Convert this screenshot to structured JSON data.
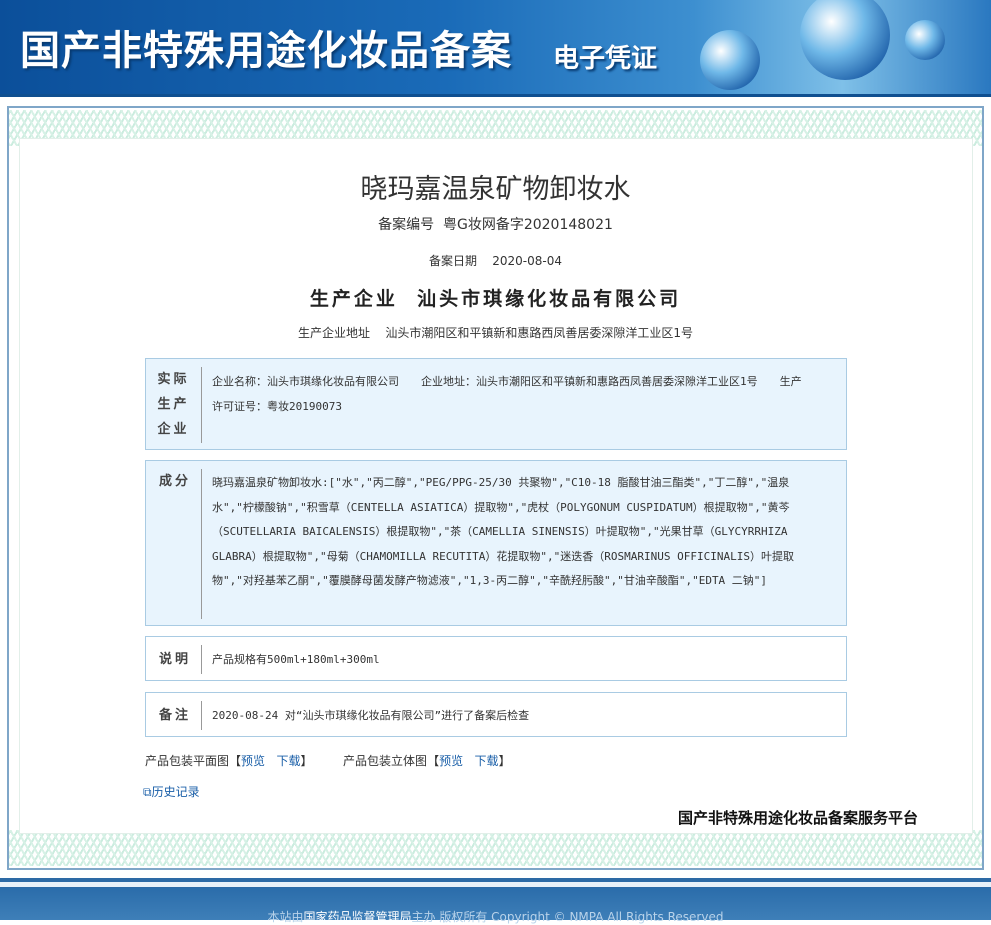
{
  "banner": {
    "title": "国产非特殊用途化妆品备案",
    "subtitle": "电子凭证"
  },
  "product": {
    "name": "晓玛嘉温泉矿物卸妆水",
    "reg_label": "备案编号",
    "reg_no": "粤G妆网备字2020148021",
    "date_label": "备案日期",
    "date": "2020-08-04",
    "maker_label": "生产企业",
    "maker": "汕头市琪缘化妆品有限公司",
    "addr_label": "生产企业地址",
    "addr": "汕头市潮阳区和平镇新和惠路西凤善居委深隙洋工业区1号"
  },
  "sections": {
    "actual": {
      "label": "实际生产企业",
      "name": "企业名称：汕头市琪缘化妆品有限公司",
      "address": "企业地址：汕头市潮阳区和平镇新和惠路西凤善居委深隙洋工业区1号",
      "license": "生产许可证号：粤妆20190073"
    },
    "ingredients": {
      "label": "成分",
      "text": "晓玛嘉温泉矿物卸妆水:[\"水\",\"丙二醇\",\"PEG/PPG-25/30 共聚物\",\"C10-18 脂酸甘油三酯类\",\"丁二醇\",\"温泉水\",\"柠檬酸钠\",\"积雪草（CENTELLA ASIATICA）提取物\",\"虎杖（POLYGONUM CUSPIDATUM）根提取物\",\"黄芩（SCUTELLARIA BAICALENSIS）根提取物\",\"茶（CAMELLIA SINENSIS）叶提取物\",\"光果甘草（GLYCYRRHIZA GLABRA）根提取物\",\"母菊（CHAMOMILLA RECUTITA）花提取物\",\"迷迭香（ROSMARINUS OFFICINALIS）叶提取物\",\"对羟基苯乙酮\",\"覆膜酵母菌发酵产物滤液\",\"1,3-丙二醇\",\"辛酰羟肟酸\",\"甘油辛酸酯\",\"EDTA 二钠\"]"
    },
    "note": {
      "label": "说明",
      "text": "产品规格有500ml+180ml+300ml"
    },
    "remark": {
      "label": "备注",
      "text": "2020-08-24 对“汕头市琪缘化妆品有限公司”进行了备案后检查"
    }
  },
  "links": {
    "flat_label": "产品包装平面图",
    "solid_label": "产品包装立体图",
    "preview": "预览",
    "download": "下载",
    "history": "历史记录"
  },
  "platform": "国产非特殊用途化妆品备案服务平台",
  "footer": {
    "prefix": "本站由",
    "org": "国家药品监督管理局",
    "suffix": "主办 版权所有 Copyright © NMPA All Rights Reserved"
  }
}
